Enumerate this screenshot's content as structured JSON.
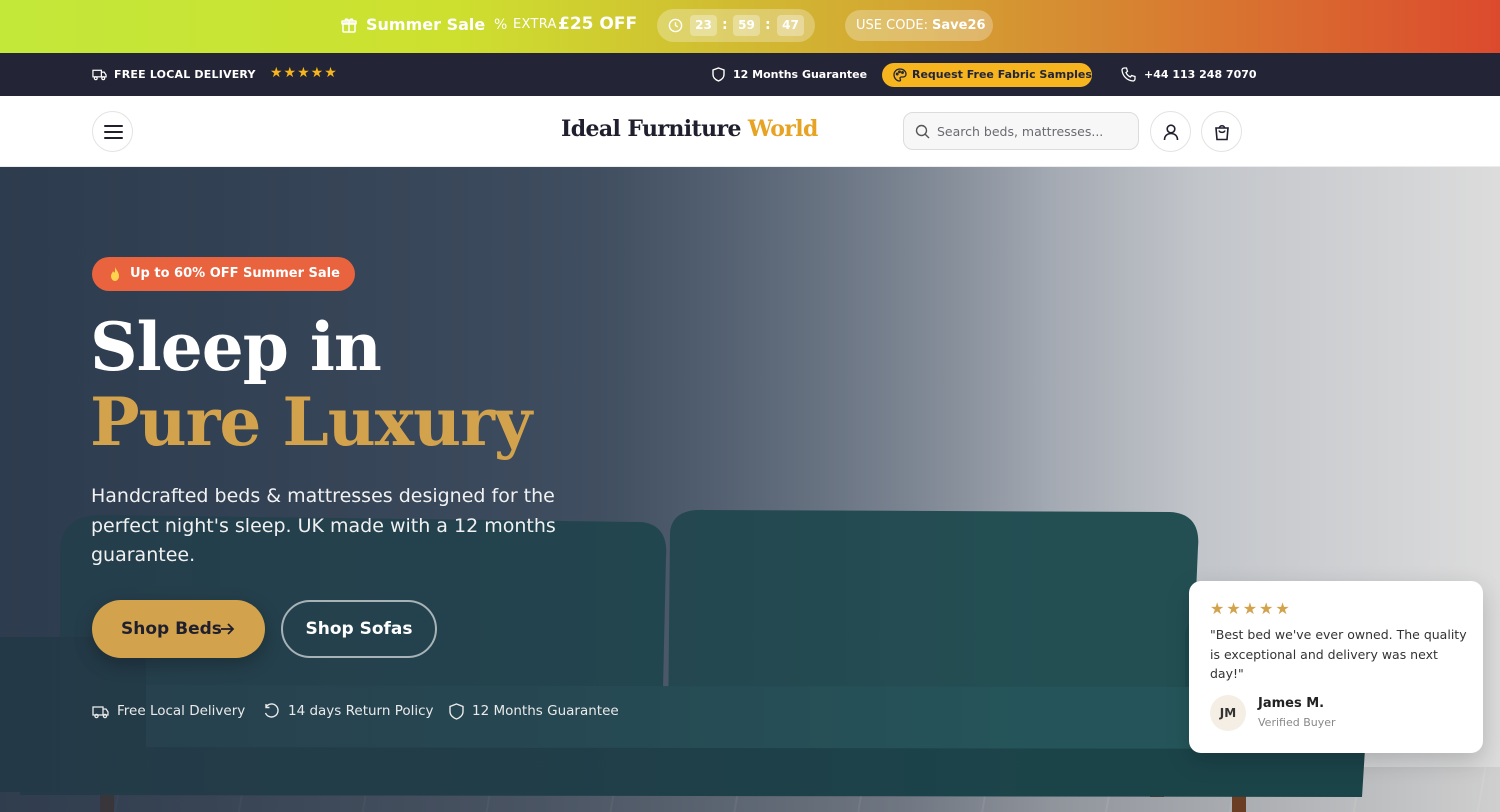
{
  "promo": {
    "sale_label": "Summer Sale",
    "extra_label": "EXTRA",
    "off_label": "£25 OFF",
    "timer": {
      "hours": "23",
      "minutes": "59",
      "seconds": "47"
    },
    "code_label": "USE CODE:",
    "code_value": "Save26"
  },
  "infobar": {
    "delivery": "FREE LOCAL DELIVERY",
    "rating_stars": "★★★★★",
    "guarantee": "12 Months Guarantee",
    "fabric_button": "Request Free Fabric Samples",
    "phone": "+44 113 248 7070"
  },
  "header": {
    "logo_main": "Ideal Furniture",
    "logo_accent": "World",
    "search_placeholder": "Search beds, mattresses..."
  },
  "hero": {
    "badge": "Up to 60% OFF Summer Sale",
    "title_line1": "Sleep in",
    "title_line2": "Pure Luxury",
    "subtitle": "Handcrafted beds & mattresses designed for the perfect night's sleep. UK made with a 12 months guarantee.",
    "cta_primary": "Shop Beds",
    "cta_secondary": "Shop Sofas",
    "features": [
      "Free Local Delivery",
      "14 days Return Policy",
      "12 Months Guarantee"
    ]
  },
  "review": {
    "stars": "★★★★★",
    "quote": "\"Best bed we've ever owned. The quality is exceptional and delivery was next day!\"",
    "initials": "JM",
    "name": "James M.",
    "role": "Verified Buyer"
  },
  "colors": {
    "accent_gold": "#d3a24c",
    "logo_accent": "#e7a324",
    "badge_orange": "#e9633f",
    "infobar_bg": "#232436",
    "fabric_yellow": "#f6b51e"
  }
}
